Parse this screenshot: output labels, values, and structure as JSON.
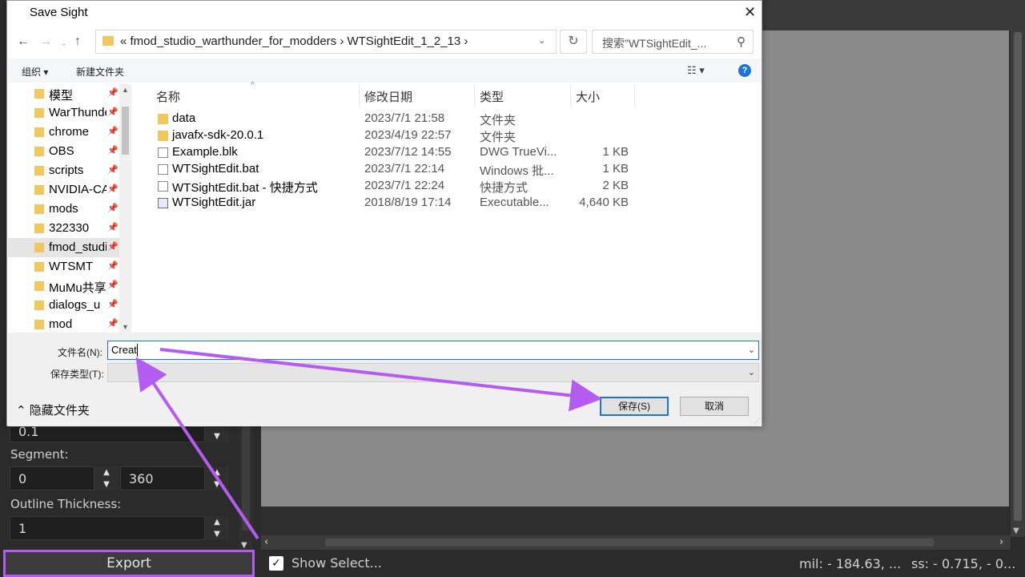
{
  "dialog": {
    "title": "Save Sight",
    "close_glyph": "✕",
    "address": {
      "breadcrumb": "« fmod_studio_warthunder_for_modders  ›  WTSightEdit_1_2_13  ›",
      "refresh_glyph": "↻"
    },
    "search_placeholder": "搜索\"WTSightEdit_...",
    "toolbar": {
      "organize": "组织 ▾",
      "new_folder": "新建文件夹",
      "help": "?"
    },
    "nav_items": [
      {
        "label": "模型"
      },
      {
        "label": "WarThunder"
      },
      {
        "label": "chrome"
      },
      {
        "label": "OBS"
      },
      {
        "label": "scripts"
      },
      {
        "label": "NVIDIA-CAT"
      },
      {
        "label": "mods"
      },
      {
        "label": "322330"
      },
      {
        "label": "fmod_studio"
      },
      {
        "label": "WTSMT"
      },
      {
        "label": "MuMu共享文件"
      },
      {
        "label": "dialogs_u"
      },
      {
        "label": "mod"
      }
    ],
    "columns": {
      "name": "名称",
      "date": "修改日期",
      "type": "类型",
      "size": "大小"
    },
    "files": [
      {
        "name": "data",
        "date": "2023/7/1 21:58",
        "type": "文件夹",
        "size": "",
        "icon": "folder-icon"
      },
      {
        "name": "javafx-sdk-20.0.1",
        "date": "2023/4/19 22:57",
        "type": "文件夹",
        "size": "",
        "icon": "folder-icon"
      },
      {
        "name": "Example.blk",
        "date": "2023/7/12 14:55",
        "type": "DWG TrueVi...",
        "size": "1 KB",
        "icon": "file-icon"
      },
      {
        "name": "WTSightEdit.bat",
        "date": "2023/7/1 22:14",
        "type": "Windows 批...",
        "size": "1 KB",
        "icon": "bat-file-icon"
      },
      {
        "name": "WTSightEdit.bat - 快捷方式",
        "date": "2023/7/1 22:24",
        "type": "快捷方式",
        "size": "2 KB",
        "icon": "shortcut-icon"
      },
      {
        "name": "WTSightEdit.jar",
        "date": "2018/8/19 17:14",
        "type": "Executable...",
        "size": "4,640 KB",
        "icon": "jar-file-icon"
      }
    ],
    "filename_label": "文件名(N):",
    "filename_value": "Creat",
    "filetype_label": "保存类型(T):",
    "filetype_value": "",
    "hide_folders": "⌃ 隐藏文件夹",
    "save_button": "保存(S)",
    "cancel_button": "取消"
  },
  "app": {
    "top_value": "0.1",
    "segment_label": "Segment:",
    "segment_from": "0",
    "segment_to": "360",
    "outline_label": "Outline Thickness:",
    "outline_value": "1",
    "export_button": "Export",
    "show_select_label": "Show Select...",
    "checkbox_glyph": "✓",
    "mil_readout": "mil: - 184.63, ...",
    "ss_readout": "ss: - 0.715, - 0...",
    "annotation_color": "#b45cf0"
  }
}
